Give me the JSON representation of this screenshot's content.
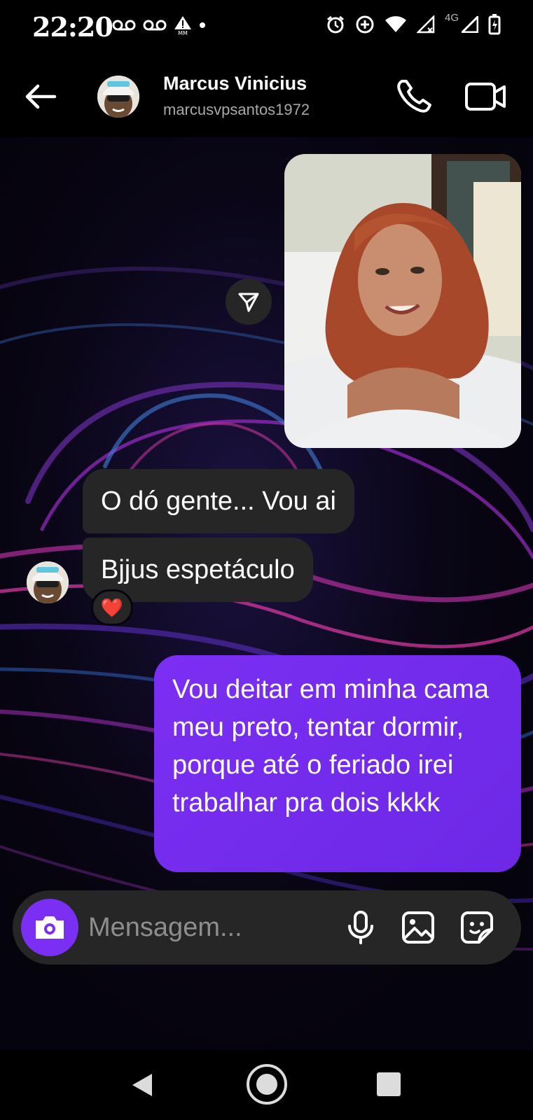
{
  "status_bar": {
    "time": "22:20",
    "network_label": "4G",
    "icons": [
      "voicemail-icon",
      "voicemail-icon",
      "alert-icon",
      "dot-icon",
      "alarm-icon",
      "data-saver-icon",
      "wifi-icon",
      "signal-icon",
      "signal-icon",
      "battery-charging-icon"
    ]
  },
  "header": {
    "name": "Marcus Vinicius",
    "username": "marcusvpsantos1972",
    "icons": [
      "back-arrow-icon",
      "avatar",
      "phone-icon",
      "video-camera-icon"
    ]
  },
  "messages": [
    {
      "type": "photo",
      "direction": "outgoing",
      "description_icon": "photo"
    },
    {
      "type": "text",
      "direction": "incoming",
      "text": "O dó gente... Vou ai"
    },
    {
      "type": "text",
      "direction": "incoming",
      "text": "Bjjus espetáculo",
      "reaction": "❤️"
    },
    {
      "type": "text",
      "direction": "outgoing",
      "text": "Vou deitar em minha cama meu preto, tentar dormir, porque até o feriado irei trabalhar pra dois kkkk"
    }
  ],
  "composer": {
    "placeholder": "Mensagem...",
    "icons": [
      "camera-icon",
      "microphone-icon",
      "gallery-icon",
      "sticker-icon"
    ]
  },
  "nav_bar": {
    "icons": [
      "nav-back-icon",
      "nav-home-icon",
      "nav-recents-icon"
    ]
  },
  "colors": {
    "accent": "#7b2ff2",
    "bubble_incoming": "#262626",
    "background": "#000000"
  }
}
